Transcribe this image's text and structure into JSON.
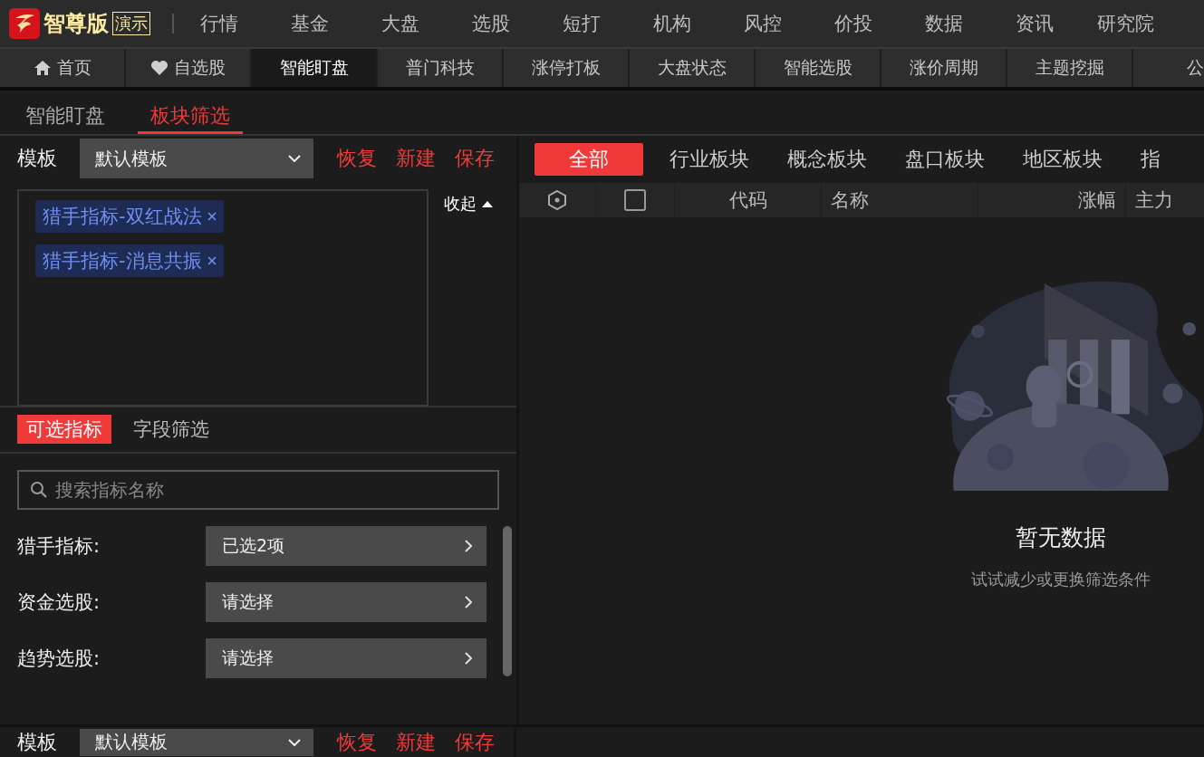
{
  "app": {
    "logo_text": "智尊版",
    "badge": "演示"
  },
  "top_menu": [
    "行情",
    "基金",
    "大盘",
    "选股",
    "短打",
    "机构",
    "风控",
    "价投",
    "数据",
    "资讯",
    "研究院"
  ],
  "nav_tabs": [
    {
      "label": "首页",
      "kind": "home",
      "selected": false
    },
    {
      "label": "自选股",
      "kind": "favorite",
      "selected": false
    },
    {
      "label": "智能盯盘",
      "selected": true
    },
    {
      "label": "普门科技",
      "selected": false
    },
    {
      "label": "涨停打板",
      "selected": false
    },
    {
      "label": "大盘状态",
      "selected": false
    },
    {
      "label": "智能选股",
      "selected": false
    },
    {
      "label": "涨价周期",
      "selected": false
    },
    {
      "label": "主题挖掘",
      "selected": false
    },
    {
      "label": "公",
      "selected": false
    }
  ],
  "sub_tabs": [
    {
      "label": "智能盯盘",
      "selected": false
    },
    {
      "label": "板块筛选",
      "selected": true
    }
  ],
  "template_bar": {
    "label": "模板",
    "value": "默认模板",
    "actions": [
      "恢复",
      "新建",
      "保存"
    ]
  },
  "selected_tags": [
    "猎手指标-双红战法",
    "猎手指标-消息共振"
  ],
  "collapse": "收起",
  "filter_tabs": [
    {
      "label": "可选指标",
      "selected": true
    },
    {
      "label": "字段筛选",
      "selected": false
    }
  ],
  "search": {
    "placeholder": "搜索指标名称"
  },
  "filters": [
    {
      "label": "猎手指标:",
      "value": "已选2项"
    },
    {
      "label": "资金选股:",
      "value": "请选择"
    },
    {
      "label": "趋势选股:",
      "value": "请选择"
    }
  ],
  "bottom_template_bar": {
    "label": "模板",
    "value": "默认模板",
    "actions": [
      "恢复",
      "新建",
      "保存"
    ]
  },
  "category_tabs": [
    {
      "label": "全部",
      "selected": true
    },
    {
      "label": "行业板块",
      "selected": false
    },
    {
      "label": "概念板块",
      "selected": false
    },
    {
      "label": "盘口板块",
      "selected": false
    },
    {
      "label": "地区板块",
      "selected": false
    },
    {
      "label": "指",
      "selected": false
    }
  ],
  "table": {
    "select_all_checked": false,
    "columns": [
      "代码",
      "名称",
      "涨幅",
      "主力"
    ]
  },
  "empty": {
    "title": "暂无数据",
    "hint": "试试减少或更换筛选条件"
  }
}
